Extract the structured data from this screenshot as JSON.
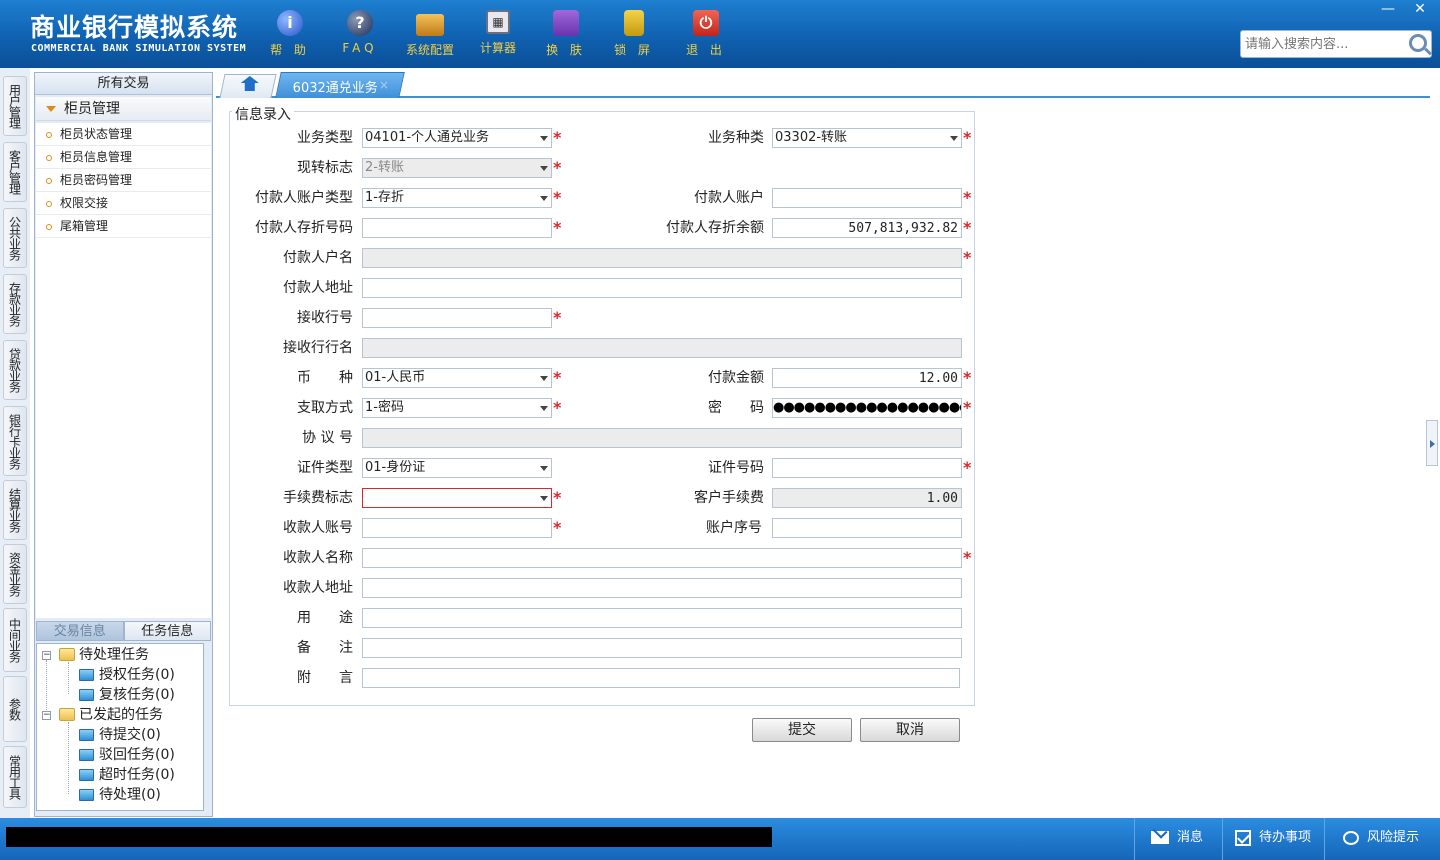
{
  "app": {
    "title": "商业银行模拟系统",
    "subtitle": "COMMERCIAL BANK SIMULATION SYSTEM"
  },
  "toolbar": [
    {
      "label": "帮 助",
      "icon": "help-icon",
      "glyph": "i"
    },
    {
      "label": "FAQ",
      "icon": "faq-icon",
      "glyph": "?"
    },
    {
      "label": "系统配置",
      "icon": "config-icon",
      "glyph": ""
    },
    {
      "label": "计算器",
      "icon": "calculator-icon",
      "glyph": "▦"
    },
    {
      "label": "换 肤",
      "icon": "skin-icon",
      "glyph": ""
    },
    {
      "label": "锁 屏",
      "icon": "lock-icon",
      "glyph": ""
    },
    {
      "label": "退 出",
      "icon": "exit-icon",
      "glyph": "⏻"
    }
  ],
  "window": {
    "minimize": "—",
    "close": "✕"
  },
  "search": {
    "placeholder": "请输入搜索内容..."
  },
  "vtabs": [
    "用户管理",
    "客户管理",
    "公共业务",
    "存款业务",
    "贷款业务",
    "银行卡业务",
    "结算业务",
    "资金业务",
    "中间业务",
    "参数",
    "常用工具"
  ],
  "leftpanel": {
    "header": "所有交易",
    "group": "柜员管理",
    "items": [
      "柜员状态管理",
      "柜员信息管理",
      "柜员密码管理",
      "权限交接",
      "尾箱管理"
    ]
  },
  "task_tabs": {
    "inactive": "交易信息",
    "active": "任务信息"
  },
  "tree": {
    "pending": {
      "label": "待处理任务",
      "children": [
        "授权任务(0)",
        "复核任务(0)"
      ]
    },
    "initiated": {
      "label": "已发起的任务",
      "children": [
        "待提交(0)",
        "驳回任务(0)",
        "超时任务(0)",
        "待处理(0)"
      ]
    }
  },
  "tabs": {
    "business": "6032通兑业务",
    "close": "×"
  },
  "form": {
    "legend": "信息录入",
    "labels": {
      "biz_type": "业务类型",
      "biz_kind": "业务种类",
      "cash_flag": "现转标志",
      "payer_acct_type": "付款人账户类型",
      "payer_acct": "付款人账户",
      "payer_book_no": "付款人存折号码",
      "payer_balance": "付款人存折余额",
      "payer_name": "付款人户名",
      "payer_addr": "付款人地址",
      "recv_bank_no": "接收行号",
      "recv_bank_name": "接收行行名",
      "currency": "币　　种",
      "pay_amount": "付款金额",
      "withdraw_method": "支取方式",
      "password": "密　　码",
      "agreement_no": "协 议 号",
      "id_type": "证件类型",
      "id_no": "证件号码",
      "fee_flag": "手续费标志",
      "cust_fee": "客户手续费",
      "payee_acct": "收款人账号",
      "acct_seq": "账户序号",
      "payee_name": "收款人名称",
      "payee_addr": "收款人地址",
      "purpose": "用　　途",
      "remark": "备　　注",
      "postscript": "附　　言"
    },
    "values": {
      "biz_type": "04101-个人通兑业务",
      "biz_kind": "03302-转账",
      "cash_flag": "2-转账",
      "payer_acct_type": "1-存折",
      "payer_acct": "",
      "payer_book_no": "",
      "payer_balance": "507,813,932.82",
      "payer_name": "",
      "payer_addr": "",
      "recv_bank_no": "",
      "recv_bank_name": "",
      "currency": "01-人民币",
      "pay_amount": "12.00",
      "withdraw_method": "1-密码",
      "password": "●●●●●●●●●●●●●●●●●●●",
      "agreement_no": "",
      "id_type": "01-身份证",
      "id_no": "",
      "fee_flag": "",
      "cust_fee": "1.00",
      "payee_acct": "",
      "acct_seq": "",
      "payee_name": "",
      "payee_addr": "",
      "purpose": "",
      "remark": "",
      "postscript": ""
    },
    "required_mark": "*"
  },
  "buttons": {
    "submit": "提交",
    "cancel": "取消"
  },
  "statusbar": {
    "messages": "消息",
    "todo": "待办事项",
    "risk": "风险提示"
  }
}
